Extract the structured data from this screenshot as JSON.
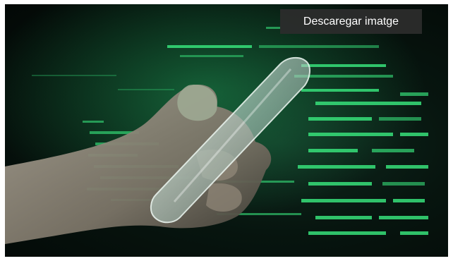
{
  "image": {
    "alt": "",
    "accent_code_color": "#37e07a",
    "hand_tone": "#c7b8a6",
    "phone_glass": "#cfe1da"
  },
  "actions": {
    "download_label": "Descaregar imatge"
  }
}
